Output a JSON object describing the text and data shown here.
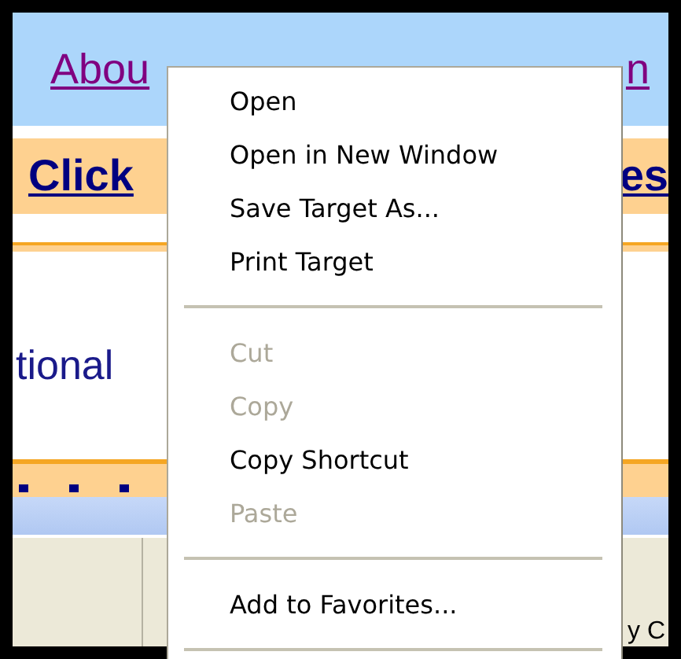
{
  "page": {
    "heading_link_left": "Abou",
    "heading_link_right": "n",
    "banner_link_left": "Click",
    "banner_link_right": "es",
    "body_text": "tional",
    "status_bar": {
      "text": "y C"
    }
  },
  "context_menu": {
    "items": [
      {
        "kind": "item",
        "label": "Open",
        "disabled": false
      },
      {
        "kind": "item",
        "label": "Open in New Window",
        "disabled": false
      },
      {
        "kind": "item",
        "label": "Save Target As...",
        "disabled": false
      },
      {
        "kind": "item",
        "label": "Print Target",
        "disabled": false
      },
      {
        "kind": "separator"
      },
      {
        "kind": "item",
        "label": "Cut",
        "disabled": true
      },
      {
        "kind": "item",
        "label": "Copy",
        "disabled": true
      },
      {
        "kind": "item",
        "label": "Copy Shortcut",
        "disabled": false
      },
      {
        "kind": "item",
        "label": "Paste",
        "disabled": true
      },
      {
        "kind": "separator"
      },
      {
        "kind": "item",
        "label": "Add to Favorites...",
        "disabled": false
      },
      {
        "kind": "separator"
      }
    ]
  }
}
